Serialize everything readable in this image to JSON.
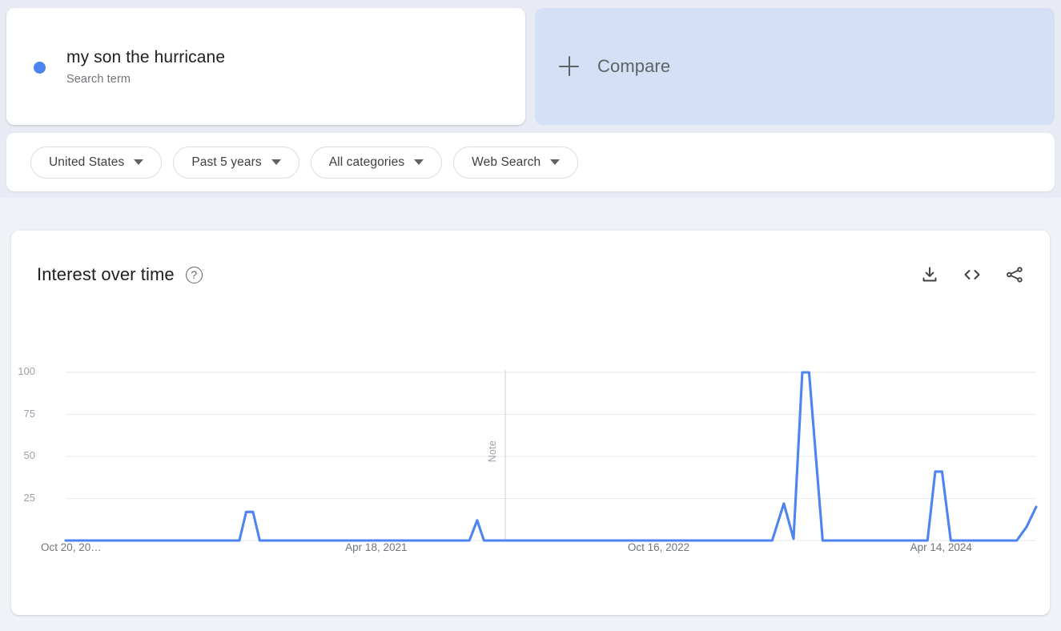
{
  "term_card": {
    "title": "my son the hurricane",
    "subtitle": "Search term",
    "dot_color": "#4e84f0",
    "dot_name": "series-color-dot"
  },
  "compare": {
    "label": "Compare",
    "icon": "plus-icon",
    "background": "#d3e0f6"
  },
  "filters": [
    {
      "label": "United States",
      "name": "filter-location"
    },
    {
      "label": "Past 5 years",
      "name": "filter-time-range"
    },
    {
      "label": "All categories",
      "name": "filter-category"
    },
    {
      "label": "Web Search",
      "name": "filter-search-type"
    }
  ],
  "chart_panel": {
    "title": "Interest over time",
    "help_glyph": "?",
    "actions": [
      {
        "name": "download-csv-button",
        "icon": "download-icon"
      },
      {
        "name": "embed-button",
        "icon": "embed-code-icon"
      },
      {
        "name": "share-button",
        "icon": "share-icon"
      }
    ]
  },
  "chart_data": {
    "type": "line",
    "title": "Interest over time",
    "xlabel": "",
    "ylabel": "",
    "ylim": [
      0,
      100
    ],
    "yticks": [
      25,
      50,
      75,
      100
    ],
    "grid": true,
    "legend": "none",
    "line_color": "#4e84f0",
    "xtick_labels": [
      "Oct 20, 20…",
      "Apr 18, 2021",
      "Oct 16, 2022",
      "Apr 14, 2024"
    ],
    "xtick_positions_pct": [
      2.8,
      32.0,
      61.1,
      90.2
    ],
    "annotations": [
      {
        "label": "Note",
        "x_pct": 45.3,
        "orientation": "vertical"
      }
    ],
    "series": [
      {
        "name": "my son the hurricane",
        "points": [
          {
            "x_pct": 0.0,
            "y": 0
          },
          {
            "x_pct": 5.0,
            "y": 0
          },
          {
            "x_pct": 10.0,
            "y": 0
          },
          {
            "x_pct": 15.0,
            "y": 0
          },
          {
            "x_pct": 17.9,
            "y": 0
          },
          {
            "x_pct": 18.6,
            "y": 17
          },
          {
            "x_pct": 19.3,
            "y": 17
          },
          {
            "x_pct": 20.0,
            "y": 0
          },
          {
            "x_pct": 25.0,
            "y": 0
          },
          {
            "x_pct": 30.0,
            "y": 0
          },
          {
            "x_pct": 35.0,
            "y": 0
          },
          {
            "x_pct": 40.0,
            "y": 0
          },
          {
            "x_pct": 41.6,
            "y": 0
          },
          {
            "x_pct": 42.4,
            "y": 12
          },
          {
            "x_pct": 43.1,
            "y": 0
          },
          {
            "x_pct": 48.0,
            "y": 0
          },
          {
            "x_pct": 55.0,
            "y": 0
          },
          {
            "x_pct": 62.0,
            "y": 0
          },
          {
            "x_pct": 68.0,
            "y": 0
          },
          {
            "x_pct": 72.8,
            "y": 0
          },
          {
            "x_pct": 74.0,
            "y": 22
          },
          {
            "x_pct": 75.0,
            "y": 1
          },
          {
            "x_pct": 75.9,
            "y": 100
          },
          {
            "x_pct": 76.6,
            "y": 100
          },
          {
            "x_pct": 78.0,
            "y": 0
          },
          {
            "x_pct": 82.0,
            "y": 0
          },
          {
            "x_pct": 86.0,
            "y": 0
          },
          {
            "x_pct": 88.8,
            "y": 0
          },
          {
            "x_pct": 89.6,
            "y": 41
          },
          {
            "x_pct": 90.3,
            "y": 41
          },
          {
            "x_pct": 91.2,
            "y": 0
          },
          {
            "x_pct": 95.0,
            "y": 0
          },
          {
            "x_pct": 98.0,
            "y": 0
          },
          {
            "x_pct": 99.0,
            "y": 8
          },
          {
            "x_pct": 100.0,
            "y": 20
          }
        ]
      }
    ]
  }
}
